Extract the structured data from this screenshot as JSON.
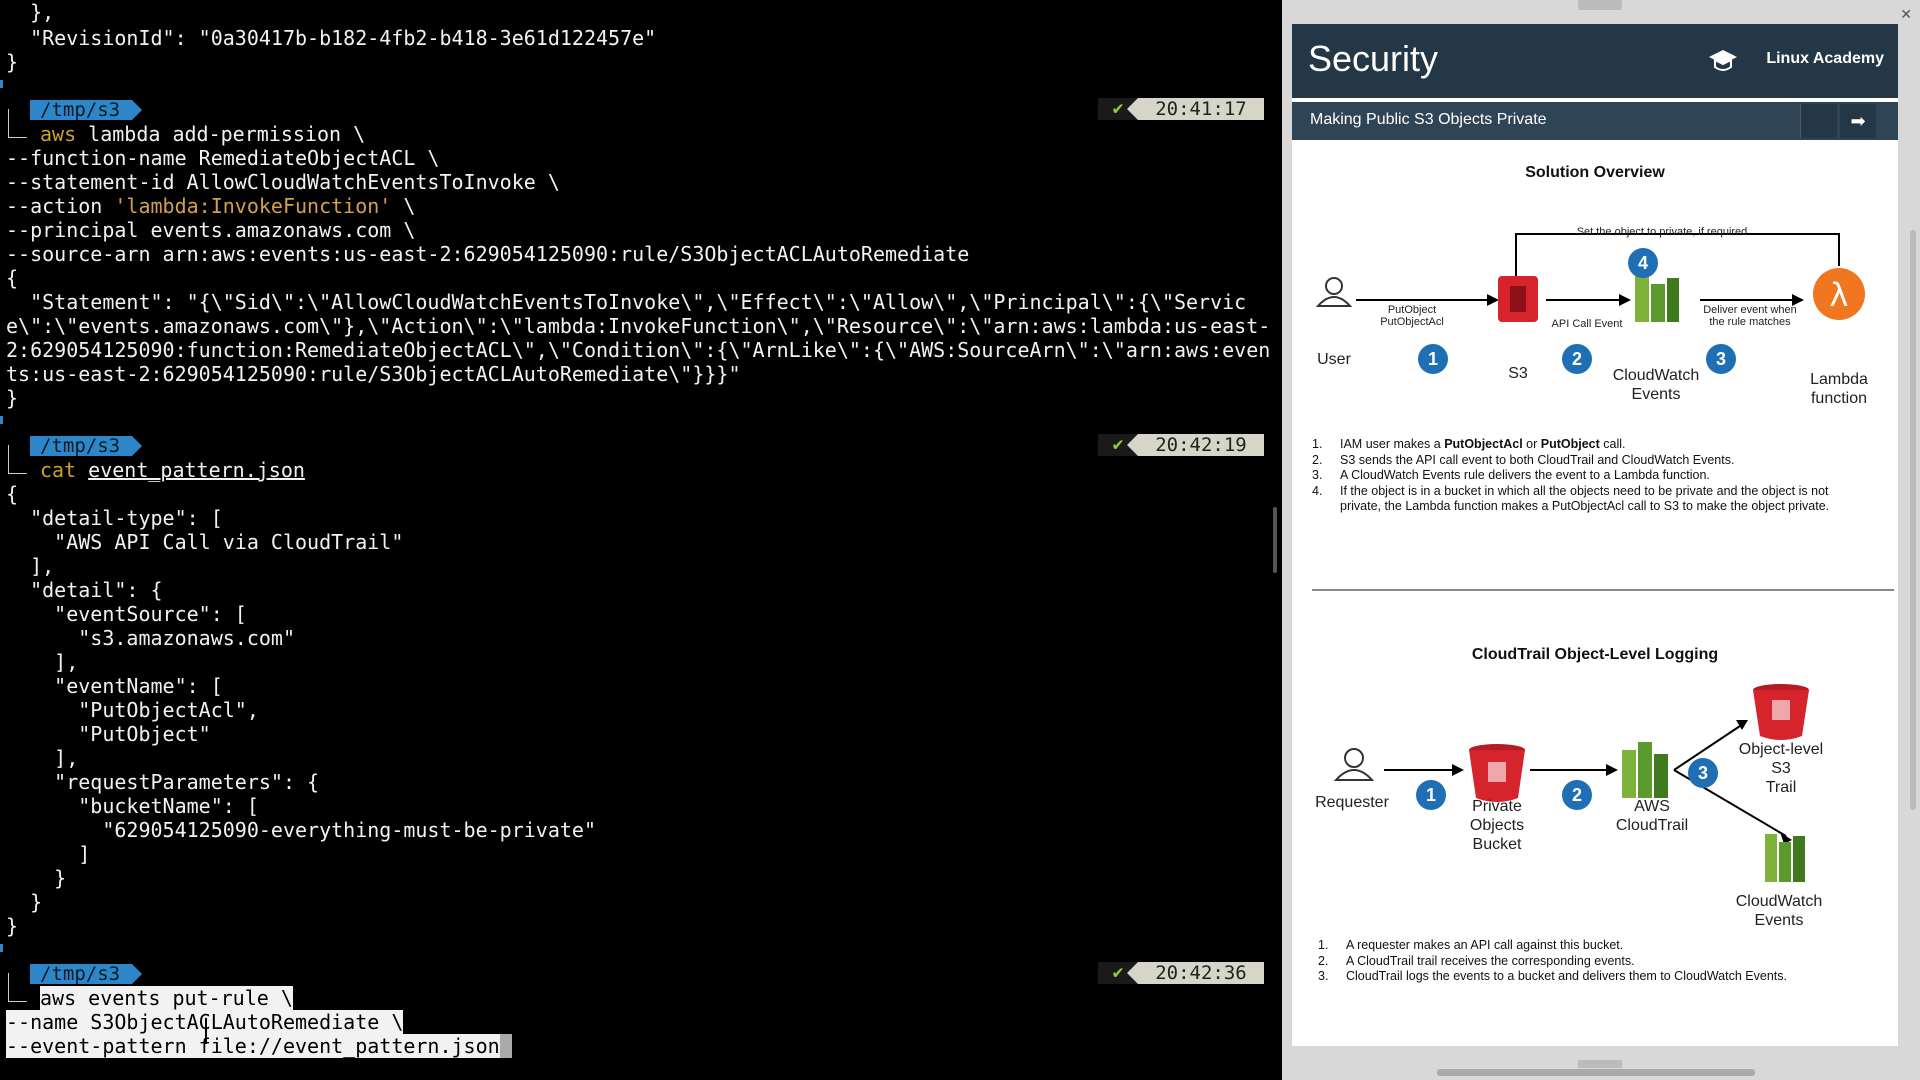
{
  "terminal": {
    "lines": [
      "  },",
      "  \"RevisionId\": \"0a30417b-b182-4fb2-b418-3e61d122457e\"",
      "}",
      "--function-name RemediateObjectACL \\",
      "--statement-id AllowCloudWatchEventsToInvoke \\",
      "--principal events.amazonaws.com \\",
      "--source-arn arn:aws:events:us-east-2:629054125090:rule/S3ObjectACLAutoRemediate",
      "{",
      "  \"Statement\": \"{\\\"Sid\\\":\\\"AllowCloudWatchEventsToInvoke\\\",\\\"Effect\\\":\\\"Allow\\\",\\\"Principal\\\":{\\\"Servic",
      "e\\\":\\\"events.amazonaws.com\\\"},\\\"Action\\\":\\\"lambda:InvokeFunction\\\",\\\"Resource\\\":\\\"arn:aws:lambda:us-east-",
      "2:629054125090:function:RemediateObjectACL\\\",\\\"Condition\\\":{\\\"ArnLike\\\":{\\\"AWS:SourceArn\\\":\\\"arn:aws:even",
      "ts:us-east-2:629054125090:rule/S3ObjectACLAutoRemediate\\\"}}}\"",
      "}",
      "{",
      "  \"detail-type\": [",
      "    \"AWS API Call via CloudTrail\"",
      "  ],",
      "  \"detail\": {",
      "    \"eventSource\": [",
      "      \"s3.amazonaws.com\"",
      "    ],",
      "    \"eventName\": [",
      "      \"PutObjectAcl\",",
      "      \"PutObject\"",
      "    ],",
      "    \"requestParameters\": {",
      "      \"bucketName\": [",
      "        \"629054125090-everything-must-be-private\"",
      "      ]",
      "    }",
      "  }",
      "}"
    ],
    "prompt_path": "/tmp/s3",
    "check": "✔",
    "times": [
      "20:41:17",
      "20:42:19",
      "20:42:36"
    ],
    "cmd1_kw": "aws",
    "cmd1_rest": " lambda add-permission \\",
    "cmd1_action_pre": "--action ",
    "cmd1_action_str": "'lambda:InvokeFunction'",
    "cmd1_action_post": " \\",
    "cmd2_kw": "cat",
    "cmd2_file": "event_pattern.json",
    "cmd3_lines": [
      "aws events put-rule \\",
      "--name S3ObjectACLAutoRemediate \\",
      "--event-pattern file://event_pattern.json"
    ]
  },
  "slide": {
    "title": "Security",
    "brand": "Linux Academy",
    "subtitle": "Making Public S3 Objects Private",
    "next_icon": "arrow-right-icon",
    "section1": {
      "heading": "Solution Overview",
      "top_label": "Set the object to private, if required",
      "user": "User",
      "put_label": "PutObject\nPutObjectAcl",
      "s3": "S3",
      "api_label": "API Call Event",
      "cw": "CloudWatch\nEvents",
      "deliver_label": "Deliver event when\nthe rule matches",
      "lambda": "Lambda\nfunction",
      "steps": [
        "1",
        "2",
        "3",
        "4"
      ],
      "list": [
        [
          "1.",
          "IAM user makes a ",
          "PutObjectAcl",
          " or ",
          "PutObject",
          " call."
        ],
        [
          "2.",
          "S3 sends the API call event to both CloudTrail and CloudWatch Events."
        ],
        [
          "3.",
          "A CloudWatch Events rule delivers the event to a Lambda function."
        ],
        [
          "4.",
          "If the object is in a bucket in which all the objects need to be private and the object is not private, the Lambda function  makes a PutObjectAcl call to S3 to make the object private."
        ]
      ]
    },
    "section2": {
      "heading": "CloudTrail Object-Level Logging",
      "requester": "Requester",
      "bucket": "Private\nObjects\nBucket",
      "cloudtrail": "AWS\nCloudTrail",
      "trail": "Object-level\nS3\nTrail",
      "cwe": "CloudWatch\nEvents",
      "steps": [
        "1",
        "2",
        "3"
      ],
      "list": [
        [
          "1.",
          "A requester makes an API call against this bucket."
        ],
        [
          "2.",
          "A CloudTrail trail receives the corresponding events."
        ],
        [
          "3.",
          "CloudTrail logs the events to a bucket  and delivers them to CloudWatch Events."
        ]
      ]
    }
  },
  "colors": {
    "accent_blue": "#1f6fb5",
    "s3_red": "#d6242d",
    "cloud_green": "#5b9a2c",
    "lambda_orange": "#f0771f",
    "header_navy": "#243746"
  }
}
